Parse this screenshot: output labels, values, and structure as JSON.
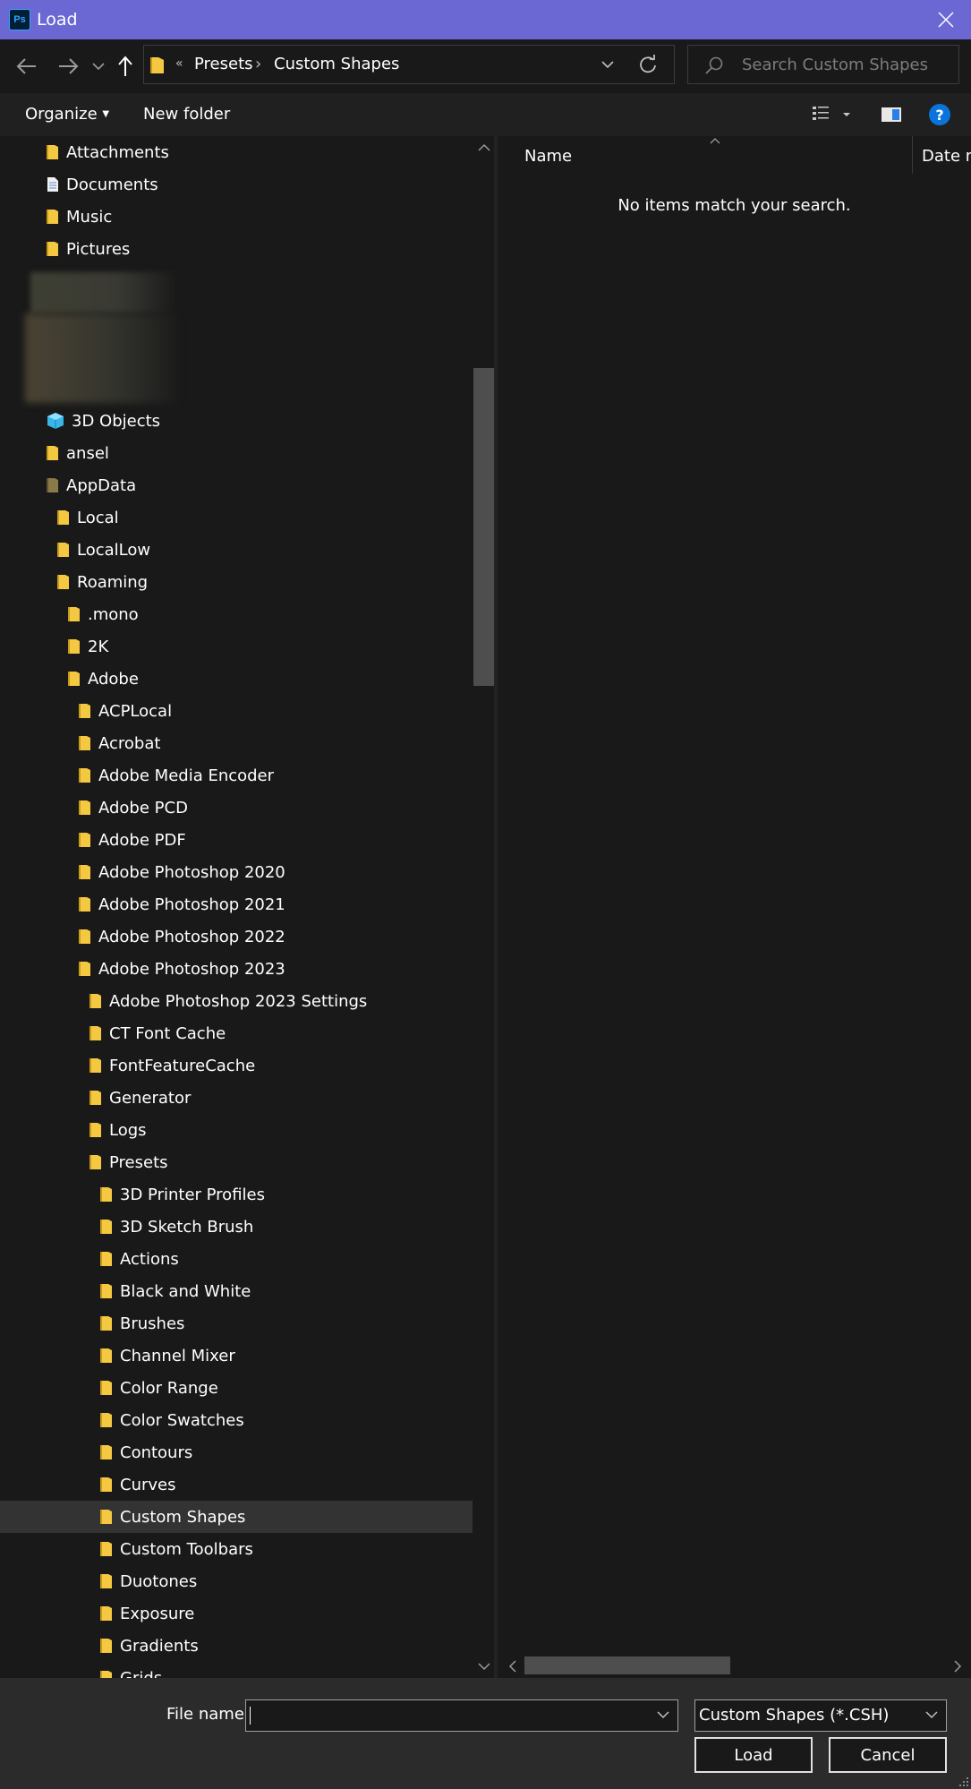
{
  "window": {
    "title": "Load",
    "app_icon": "Ps"
  },
  "address": {
    "overflow_glyph": "«",
    "crumbs": [
      "Presets",
      "Custom Shapes"
    ],
    "separator": "›"
  },
  "search": {
    "placeholder": "Search Custom Shapes"
  },
  "toolbar": {
    "organize": "Organize",
    "new_folder": "New folder",
    "help_glyph": "?"
  },
  "tree": [
    {
      "label": "Attachments",
      "icon": "folder"
    },
    {
      "label": "Documents",
      "icon": "document"
    },
    {
      "label": "Music",
      "icon": "folder"
    },
    {
      "label": "Pictures",
      "icon": "folder"
    },
    {
      "label": "3D Objects",
      "icon": "3d-object"
    },
    {
      "label": "ansel",
      "icon": "folder"
    },
    {
      "label": "AppData",
      "icon": "folder-dim"
    },
    {
      "label": "Local",
      "icon": "folder"
    },
    {
      "label": "LocalLow",
      "icon": "folder"
    },
    {
      "label": "Roaming",
      "icon": "folder"
    },
    {
      "label": ".mono",
      "icon": "folder"
    },
    {
      "label": "2K",
      "icon": "folder"
    },
    {
      "label": "Adobe",
      "icon": "folder"
    },
    {
      "label": "ACPLocal",
      "icon": "folder"
    },
    {
      "label": "Acrobat",
      "icon": "folder"
    },
    {
      "label": "Adobe Media Encoder",
      "icon": "folder"
    },
    {
      "label": "Adobe PCD",
      "icon": "folder"
    },
    {
      "label": "Adobe PDF",
      "icon": "folder"
    },
    {
      "label": "Adobe Photoshop 2020",
      "icon": "folder"
    },
    {
      "label": "Adobe Photoshop 2021",
      "icon": "folder"
    },
    {
      "label": "Adobe Photoshop 2022",
      "icon": "folder"
    },
    {
      "label": "Adobe Photoshop 2023",
      "icon": "folder"
    },
    {
      "label": "Adobe Photoshop 2023 Settings",
      "icon": "folder"
    },
    {
      "label": "CT Font Cache",
      "icon": "folder"
    },
    {
      "label": "FontFeatureCache",
      "icon": "folder"
    },
    {
      "label": "Generator",
      "icon": "folder"
    },
    {
      "label": "Logs",
      "icon": "folder"
    },
    {
      "label": "Presets",
      "icon": "folder"
    },
    {
      "label": "3D Printer Profiles",
      "icon": "folder"
    },
    {
      "label": "3D Sketch Brush",
      "icon": "folder"
    },
    {
      "label": "Actions",
      "icon": "folder"
    },
    {
      "label": "Black and White",
      "icon": "folder"
    },
    {
      "label": "Brushes",
      "icon": "folder"
    },
    {
      "label": "Channel Mixer",
      "icon": "folder"
    },
    {
      "label": "Color Range",
      "icon": "folder"
    },
    {
      "label": "Color Swatches",
      "icon": "folder"
    },
    {
      "label": "Contours",
      "icon": "folder"
    },
    {
      "label": "Curves",
      "icon": "folder"
    },
    {
      "label": "Custom Shapes",
      "icon": "folder",
      "selected": true
    },
    {
      "label": "Custom Toolbars",
      "icon": "folder"
    },
    {
      "label": "Duotones",
      "icon": "folder"
    },
    {
      "label": "Exposure",
      "icon": "folder"
    },
    {
      "label": "Gradients",
      "icon": "folder"
    },
    {
      "label": "Grids",
      "icon": "folder"
    }
  ],
  "content": {
    "columns": [
      "Name",
      "Date m"
    ],
    "empty_message": "No items match your search."
  },
  "bottom": {
    "file_name_label": "File name:",
    "file_name_value": "",
    "filter_value": "Custom Shapes (*.CSH)",
    "load_button": "Load",
    "cancel_button": "Cancel"
  },
  "colors": {
    "titlebar": "#6b68d4",
    "background": "#191919",
    "folder": "#f5c842",
    "selected_row": "#333333",
    "help": "#0a74da"
  }
}
